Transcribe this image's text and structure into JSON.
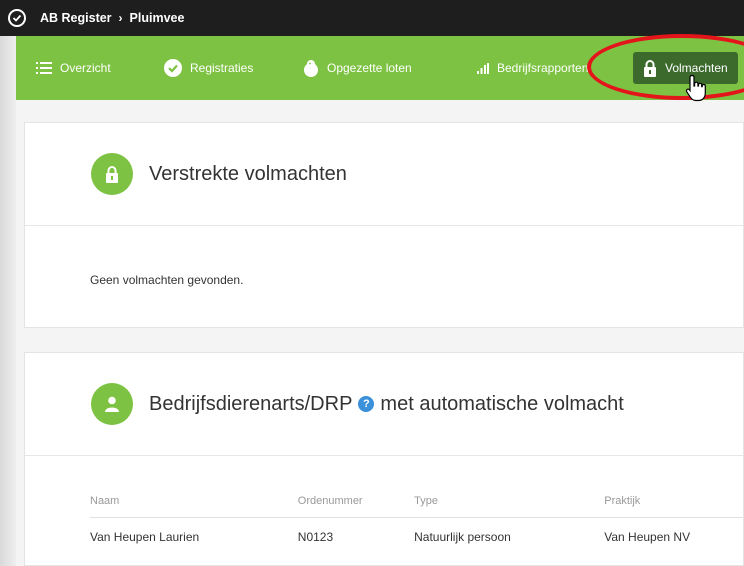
{
  "topbar": {
    "app": "AB Register",
    "separator": "›",
    "section": "Pluimvee"
  },
  "nav": {
    "items": [
      {
        "label": "Overzicht",
        "icon": "list-icon"
      },
      {
        "label": "Registraties",
        "icon": "check-circle-icon"
      },
      {
        "label": "Opgezette loten",
        "icon": "chick-icon"
      },
      {
        "label": "Bedrijfsrapporten",
        "icon": "bar-chart-icon"
      },
      {
        "label": "Volmachten",
        "icon": "lock-icon",
        "active": true
      }
    ]
  },
  "card1": {
    "title": "Verstrekte volmachten",
    "empty_text": "Geen volmachten gevonden."
  },
  "card2": {
    "title_part1": "Bedrijfsdierenarts/DRP",
    "help": "?",
    "title_part2": "met automatische volmacht",
    "columns": [
      "Naam",
      "Ordenummer",
      "Type",
      "Praktijk"
    ],
    "rows": [
      [
        "Van Heupen Laurien",
        "N0123",
        "Natuurlijk persoon",
        "Van Heupen NV"
      ]
    ]
  },
  "colors": {
    "green": "#7dc242",
    "dark_green": "#3c6a2d",
    "topbar": "#1e1e1e",
    "annotation": "#e4141b",
    "help": "#3a90d9"
  }
}
